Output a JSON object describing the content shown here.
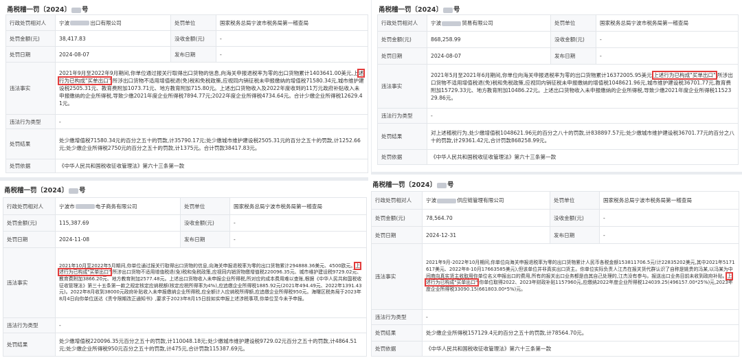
{
  "labels": {
    "party": "行政处罚相对人",
    "fine": "处罚金额(元)",
    "confiscation": "没收金额(元)",
    "date": "处罚日期",
    "publish": "发布日期",
    "unit": "处罚单位",
    "facts": "违法事实",
    "type": "违法行为类型",
    "result": "处罚结果",
    "basis": "处罚依据"
  },
  "records": [
    {
      "title_prefix": "甬税稽一罚〔2024〕",
      "title_suffix": "号",
      "party_a": "宁波",
      "party_b": "出口有限公司",
      "unit": "国家税务总局宁波市税务局第一稽查局",
      "fine": "38,417.83",
      "confiscation": "-",
      "date": "2024-08-07",
      "publish": "-",
      "facts_a": "2021年9月至2022年9月期间,你单位通过报关行取得出口货物的信息,向海关申报退税率为零的出口货物累计1403641.00美元,上",
      "facts_hl": "述行为已构成\"买单出口\"",
      "facts_b": ",所涉出口货物不适用增值税退(免)税和免税政策,应视同内销征税未申报缴纳的增值税71580.34元,城市维护建设税2505.31元、教育费附加1073.71元、地方教育附加715.80元。上述出口货物收入及2022年度收到的11万元政府补贴收入未申报缴纳的企业所得税,导致少缴2021年度企业所得税7894.77元;2022年度企业所得税4734.64元。合计少缴企业所得税12629.41元。",
      "type": "-",
      "result": "处少缴增值税71580.34元的百分之五十的罚款,计35790.17元;处少缴城市维护建设税2505.31元的百分之五十的罚款,计1252.66元;处少缴企业所得税2750元的百分之五十的罚款,计1375元。合计罚款38417.83元。",
      "basis": "《中华人民共和国税收征收管理法》第六十三条第一款"
    },
    {
      "title_prefix": "甬税稽一罚〔2024〕",
      "title_suffix": "号",
      "party_a": "宁波",
      "party_b": "贸易有限公司",
      "unit": "国家税务总局宁波市税务局第一稽查局",
      "fine": "868,258.99",
      "confiscation": "-",
      "date": "2024-08-07",
      "publish": "-",
      "facts_a": "2021年5月至2021年6月期间,你单位向海关申报退税率为零的出口货物累计16372005.95美元,",
      "facts_hl": "上述行为已构成\"买单出口\"",
      "facts_b": ",所涉出口货物不适用增值税退(免)税和免税政策,应视同内销征税未申报缴纳的增值税1048621.96元,城市维护建设税36701.77元,教育费附加15729.33元、地方教育附加10486.22元。上述出口货物收入未申报缴纳的企业所得税,导致少缴2021年度企业所得税1152329.86元。",
      "type": "-",
      "result": "对上述稽税行为,处少缴增值税1048621.96元的百分之八十的罚款,计838897.57元;处少缴城市维护建设税36701.77元的百分之八十的罚款,计29361.42元,合计罚款868258.99元。",
      "basis": "《中华人民共和国税收征收管理法》第六十三条第一款"
    },
    {
      "title_prefix": "甬税稽一罚〔2024〕",
      "title_suffix": "号",
      "party_a": "宁波市",
      "party_b": "电子商务有限公司",
      "unit": "国家税务总局宁波市税务局第一稽查局",
      "fine": "115,387.69",
      "confiscation": "-",
      "date": "2024-11-08",
      "publish": "-",
      "facts_a": "2021年10月至2022年5月期间,你单位通过报关行取得出口货物的信息,向海关申报退税率为零的出口货物累计294888.36美元、4500欧元。",
      "facts_hl": "上述行为已构成\"买单出口\"",
      "facts_b": ",所涉出口货物不适用增值税退(免)税和免税政策,应视同内销货物缴增值税220096.35元、城市维护建设税9729.02元、教育费附加3866.20元、地方教育附加2577.48元。上述出口货物收入未申报企业所得税,所对应的成本费用难以查账,根据《中华人民共和国税收征收管理法》第三十五条第一款之规定核定应纳税额(核定应税所得率为4%),应追缴企业所得税1885.92元(2021年494.49元、2022年1391.43元)。2022年8月收到38000元政府补贴收入未申报缴纳企业所得税,应全额计入应纳税所得额,应追缴企业所得税950元。海曙区税务局于2023年8月4日向你单位送达《责令限期改正通知书》,要求于2023年8月15日前如实申报上述涉税事项,你单位至今未予申报。",
      "type": "-",
      "result": "处少缴增值税220096.35元百分之五十的罚款,计110048.18元;处少缴城市维护建设税9729.02元百分之五十的罚款,计4864.51元;处少缴企业所得税950元百分之五十的罚款,计475元,合计罚款115387.69元。",
      "basis": ""
    },
    {
      "title_prefix": "甬税稽一罚〔2024〕",
      "title_suffix": "号",
      "party_a": "宁波",
      "party_b": "供应链管理有限公司",
      "unit": "国家税务总局宁波市税务局第一稽查局",
      "fine": "78,564.70",
      "confiscation": "-",
      "date": "2024-12-31",
      "publish": "-",
      "facts_a": "2021年9月-2022年10月期间,你单位向海关申报退税率为零的出口货物累计人民币各税金额153811706.5元(计22835202美元,其中2021年5171617美元、2022年8-10月17663585美元),但该单位并非真实出口货主。你单位实际负责人江杰在报关货代群认识了自称是姚贵的冯某,以冯某为中间商向真实货主收取用你单位名义申报出口的费用,所有的报关出口业务都是由其自己处理的,江杰没有参与。报送出口业务目前未收到政府补贴。",
      "facts_hl": "上述行为已构成\"买单出口\"",
      "facts_b": ",你单位取得2022、2023年财政补贴1157960元,应缴纳2022年度企业所得税124039.25(496157.00*25%)元,2023年度企业所得税33090.15(661803.00*5%)元。",
      "type": "-",
      "result": "处少缴企业所得税157129.4元的百分之五十的罚款,计78564.70元。",
      "basis": "《中华人民共和国税收征收管理法》第六十三条第一款"
    }
  ]
}
